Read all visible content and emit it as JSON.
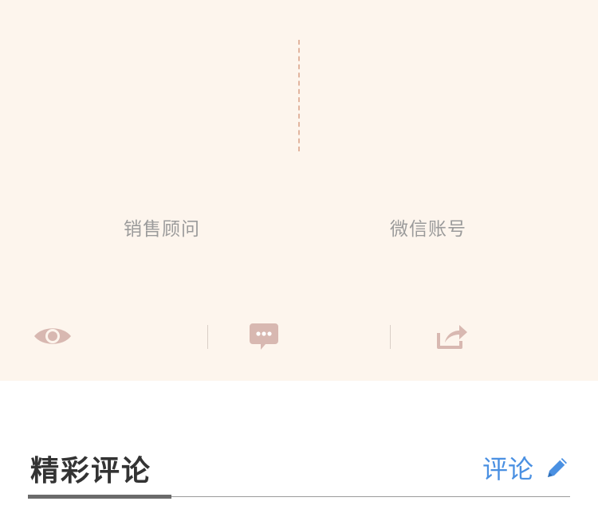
{
  "contact": {
    "left_label": "销售顾问",
    "right_label": "微信账号"
  },
  "actions": {
    "view_icon": "eye-icon",
    "comment_icon": "chat-bubble-icon",
    "share_icon": "share-icon"
  },
  "comments": {
    "title": "精彩评论",
    "link_label": "评论",
    "link_icon": "pencil-icon"
  },
  "colors": {
    "card_bg": "#fdf5ed",
    "accent_icon": "#d8b8b1",
    "dash": "#e2b59f",
    "link": "#4a90e2"
  }
}
